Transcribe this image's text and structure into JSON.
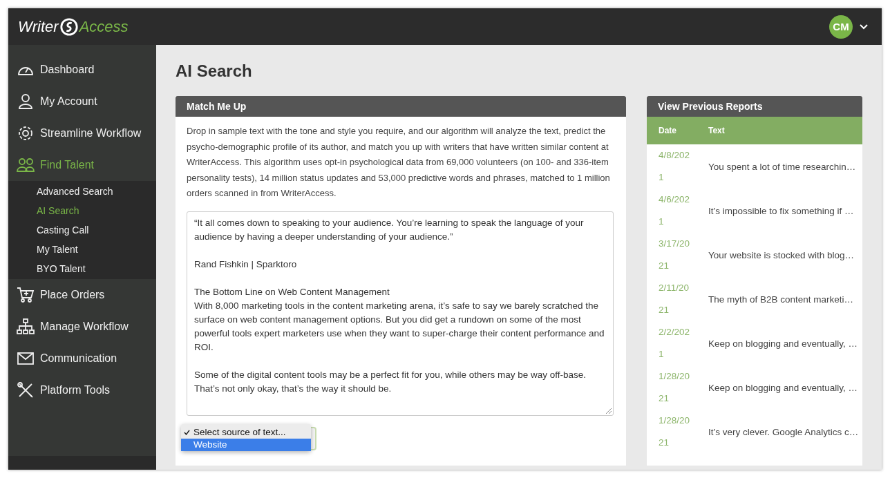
{
  "brand": {
    "left": "Writer",
    "right": "Access"
  },
  "user": {
    "initials": "CM"
  },
  "sidebar": {
    "items": [
      {
        "label": "Dashboard",
        "selected": false
      },
      {
        "label": "My Account",
        "selected": false
      },
      {
        "label": "Streamline Workflow",
        "selected": false
      },
      {
        "label": "Find Talent",
        "selected": true,
        "children": [
          {
            "label": "Advanced Search",
            "selected": false
          },
          {
            "label": "AI Search",
            "selected": true
          },
          {
            "label": "Casting Call",
            "selected": false
          },
          {
            "label": "My Talent",
            "selected": false
          },
          {
            "label": "BYO Talent",
            "selected": false
          }
        ]
      },
      {
        "label": "Place Orders",
        "selected": false
      },
      {
        "label": "Manage Workflow",
        "selected": false
      },
      {
        "label": "Communication",
        "selected": false
      },
      {
        "label": "Platform Tools",
        "selected": false
      }
    ]
  },
  "page_title": "AI Search",
  "match_card": {
    "title": "Match Me Up",
    "description": "Drop in sample text with the tone and style you require, and our algorithm will analyze the text, predict the psycho-demographic profile of its author, and match you up with writers that have written similar content at WriterAccess. This algorithm uses opt-in psychological data from 69,000 volunteers (on 100- and 336-item personality tests), 14 million status updates and 53,000 predictive words and phrases, matched to 1 million orders scanned in from WriterAccess.",
    "sample_text": [
      [
        "“It all comes down to speaking to your audience. You’re learning to speak the language of your audience by having a deeper understanding of your audience.”"
      ],
      [
        "Rand Fishkin | Sparktoro"
      ],
      [
        "The Bottom Line on Web Content Management",
        "With 8,000 marketing tools in the content marketing arena, it’s safe to say we barely scratched the surface on web content management options. But you did get a rundown on some of the most powerful tools expert marketers use when they want to super-charge their content performance and ROI."
      ],
      [
        "Some of the digital content tools may be a perfect fit for you, while others may be way off-base. That’s not only okay, that’s the way it should be."
      ]
    ],
    "source_dropdown": {
      "options": [
        {
          "label": "Select source of text...",
          "checked": true,
          "selected": false
        },
        {
          "label": "Website",
          "checked": false,
          "selected": true
        }
      ]
    }
  },
  "reports": {
    "title": "View Previous Reports",
    "columns": [
      "Date",
      "Text"
    ],
    "rows": [
      {
        "date": "4/8/2021",
        "text": "You spent a lot of time researchin…"
      },
      {
        "date": "4/6/2021",
        "text": "It’s impossible to fix something if …"
      },
      {
        "date": "3/17/2021",
        "text": "Your website is stocked with blog…"
      },
      {
        "date": "2/11/2021",
        "text": "The myth of B2B content marketi…"
      },
      {
        "date": "2/2/2021",
        "text": "Keep on blogging and eventually, …"
      },
      {
        "date": "1/28/2021",
        "text": "Keep on blogging and eventually, …"
      },
      {
        "date": "1/28/2021",
        "text": "It’s very clever. Google Analytics c…"
      }
    ]
  }
}
